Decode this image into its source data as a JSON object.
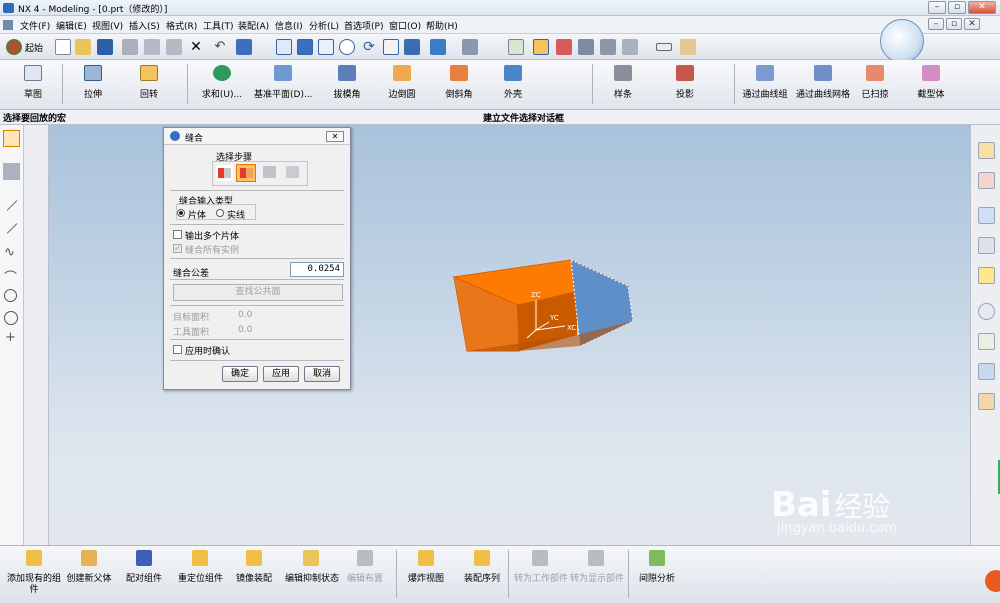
{
  "window": {
    "title": "NX 4 - Modeling - [0.prt（修改的）]",
    "min": "–",
    "restore": "▫",
    "close": "✕"
  },
  "menu": [
    "文件(F)",
    "编辑(E)",
    "视图(V)",
    "插入(S)",
    "格式(R)",
    "工具(T)",
    "装配(A)",
    "信息(I)",
    "分析(L)",
    "首选项(P)",
    "窗口(O)",
    "帮助(H)"
  ],
  "toolbar1": {
    "start_label": "起始"
  },
  "toolbar2": {
    "items": [
      "草图",
      "拉伸",
      "回转",
      "求和(U)...",
      "基准平面(D)...",
      "拔模角",
      "边倒圆",
      "倒斜角",
      "外壳",
      "样条",
      "投影",
      "通过曲线组",
      "通过曲线网格",
      "已扫掠",
      "截型体"
    ]
  },
  "status": {
    "left": "选择要回放的宏",
    "center": "建立文件选择对话框"
  },
  "dialog": {
    "title": "缝合",
    "steps_label": "选择步骤",
    "input_type_label": "缝合输入类型",
    "radio_sheet": "片体",
    "radio_solid": "实线",
    "output_multiple": "输出多个片体",
    "sew_all_instances": "缝合所有实例",
    "tolerance_label": "缝合公差",
    "tolerance_value": "0.0254",
    "find_common_faces": "查找公共面",
    "target_area_label": "目标面积",
    "target_area_value": "0.0",
    "tool_area_label": "工具面积",
    "tool_area_value": "0.0",
    "confirm_on_apply": "应用时确认",
    "ok": "确定",
    "apply": "应用",
    "cancel": "取消"
  },
  "viewport": {
    "axes": {
      "zc": "ZC",
      "yc": "YC",
      "xc": "XC"
    }
  },
  "bottom": {
    "items": [
      {
        "label": "添加现有的组\n件",
        "enabled": true
      },
      {
        "label": "创建新父体",
        "enabled": true
      },
      {
        "label": "配对组件",
        "enabled": true
      },
      {
        "label": "重定位组件",
        "enabled": true
      },
      {
        "label": "镜像装配",
        "enabled": true
      },
      {
        "label": "编辑抑制状态",
        "enabled": true
      },
      {
        "label": "编辑布置",
        "enabled": false
      },
      {
        "label": "爆炸视图",
        "enabled": true
      },
      {
        "label": "装配序列",
        "enabled": true
      },
      {
        "label": "转为工作部件",
        "enabled": false
      },
      {
        "label": "转为显示部件",
        "enabled": false
      },
      {
        "label": "间隙分析",
        "enabled": true
      }
    ]
  },
  "watermark": {
    "brand": "Bai",
    "text": "经验",
    "url": "jingyan.baidu.com"
  },
  "colors": {
    "accent_orange": "#ff7a00",
    "viewport_top": "#a9c2db",
    "face_blue": "#5f8fc8"
  }
}
